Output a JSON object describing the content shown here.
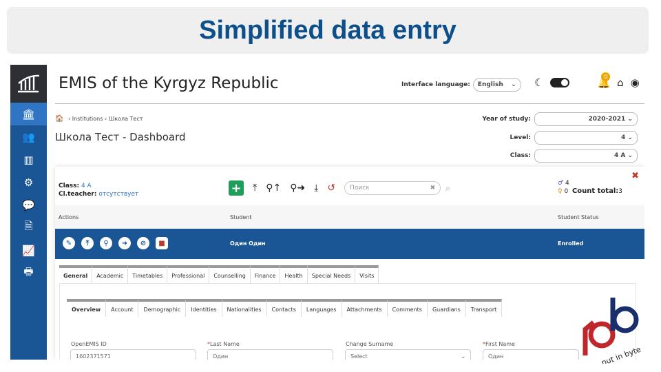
{
  "banner": {
    "title": "Simplified data entry"
  },
  "app": {
    "title": "EMIS of the Kyrgyz Republic",
    "interface_language_label": "Interface language:",
    "interface_language_value": "English",
    "notification_count": "0"
  },
  "sidebar": {
    "items": [
      {
        "icon": "institution-icon",
        "active": true
      },
      {
        "icon": "users-icon"
      },
      {
        "icon": "bar-chart-icon"
      },
      {
        "icon": "gears-icon"
      },
      {
        "icon": "comments-icon"
      },
      {
        "icon": "document-icon"
      },
      {
        "icon": "line-chart-icon"
      },
      {
        "icon": "print-icon"
      }
    ]
  },
  "breadcrumb": {
    "items": [
      "Institutions",
      "Школа Тест"
    ]
  },
  "dashboard_title": "Школа Тест - Dashboard",
  "filters": {
    "year_label": "Year of study:",
    "year_value": "2020-2021",
    "level_label": "Level:",
    "level_value": "4",
    "class_label": "Class:",
    "class_value": "4 A"
  },
  "class_panel": {
    "class_label": "Class:",
    "class_value": "4 A",
    "teacher_label": "Cl.teacher:",
    "teacher_value": "отсутствует",
    "search_placeholder": "Поиск",
    "male_count": "4",
    "female_count": "0",
    "count_total_label": "Count total:",
    "count_total_value": "3",
    "columns": {
      "actions": "Actions",
      "student": "Student",
      "status": "Student Status"
    },
    "row": {
      "student": "Один Один",
      "status": "Enrolled"
    }
  },
  "tabs_main": [
    "General",
    "Academic",
    "Timetables",
    "Professional",
    "Counselling",
    "Finance",
    "Health",
    "Special Needs",
    "Visits"
  ],
  "tabs_sub": [
    "Overview",
    "Account",
    "Demographic",
    "Identities",
    "Nationalities",
    "Contacts",
    "Languages",
    "Attachments",
    "Comments",
    "Guardians",
    "Transport"
  ],
  "form": {
    "openemis_label": "OpenEMIS ID",
    "openemis_value": "1602371571",
    "last_name_label": "Last Name",
    "last_name_value": "Один",
    "change_surname_label": "Change Surname",
    "change_surname_value": "Select",
    "first_name_label": "First Name",
    "first_name_value": "Один"
  },
  "watermark": {
    "text": "put in byte"
  },
  "colors": {
    "brand_blue": "#1a5696",
    "accent_blue": "#2f75c4",
    "green": "#1e9e5a",
    "red": "#c0392b",
    "banner_text": "#0d4f8b"
  }
}
